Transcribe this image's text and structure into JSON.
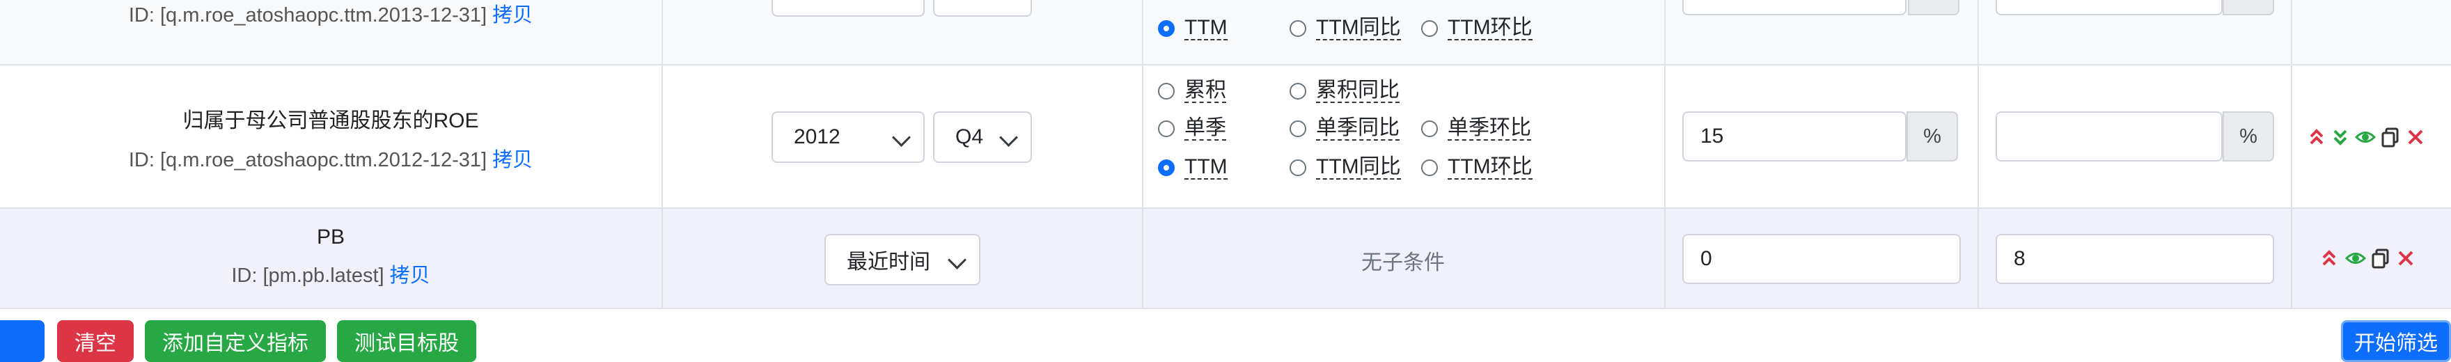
{
  "rows": [
    {
      "id_prefix": "ID: [q.m.roe_atoshaopc.ttm.2013-12-31]",
      "copy_label": "拷贝",
      "radios": [
        {
          "label": "TTM",
          "checked": true
        },
        {
          "label": "TTM同比",
          "checked": false
        },
        {
          "label": "TTM环比",
          "checked": false
        }
      ]
    },
    {
      "name": "归属于母公司普通股股东的ROE",
      "id_prefix": "ID: [q.m.roe_atoshaopc.ttm.2012-12-31]",
      "copy_label": "拷贝",
      "year": "2012",
      "quarter": "Q4",
      "radios": [
        {
          "label": "累积",
          "checked": false
        },
        {
          "label": "累积同比",
          "checked": false
        },
        {
          "label": "单季",
          "checked": false
        },
        {
          "label": "单季同比",
          "checked": false
        },
        {
          "label": "单季环比",
          "checked": false
        },
        {
          "label": "TTM",
          "checked": true
        },
        {
          "label": "TTM同比",
          "checked": false
        },
        {
          "label": "TTM环比",
          "checked": false
        }
      ],
      "min_value": "15",
      "max_value": "",
      "unit": "%"
    },
    {
      "name": "PB",
      "id_prefix": "ID: [pm.pb.latest]",
      "copy_label": "拷贝",
      "period": "最近时间",
      "no_condition": "无子条件",
      "min_value": "0",
      "max_value": "8"
    }
  ],
  "buttons": {
    "clear": "清空",
    "add_custom": "添加自定义指标",
    "test_stock": "测试目标股",
    "start": "开始筛选"
  },
  "colors": {
    "primary": "#0d6efd",
    "danger": "#dc3545",
    "success": "#28a745",
    "row_highlight": "#f1f1fc"
  },
  "icons": [
    "double-chevron-up-icon",
    "double-chevron-down-icon",
    "eye-icon",
    "copy-icon",
    "close-icon"
  ]
}
